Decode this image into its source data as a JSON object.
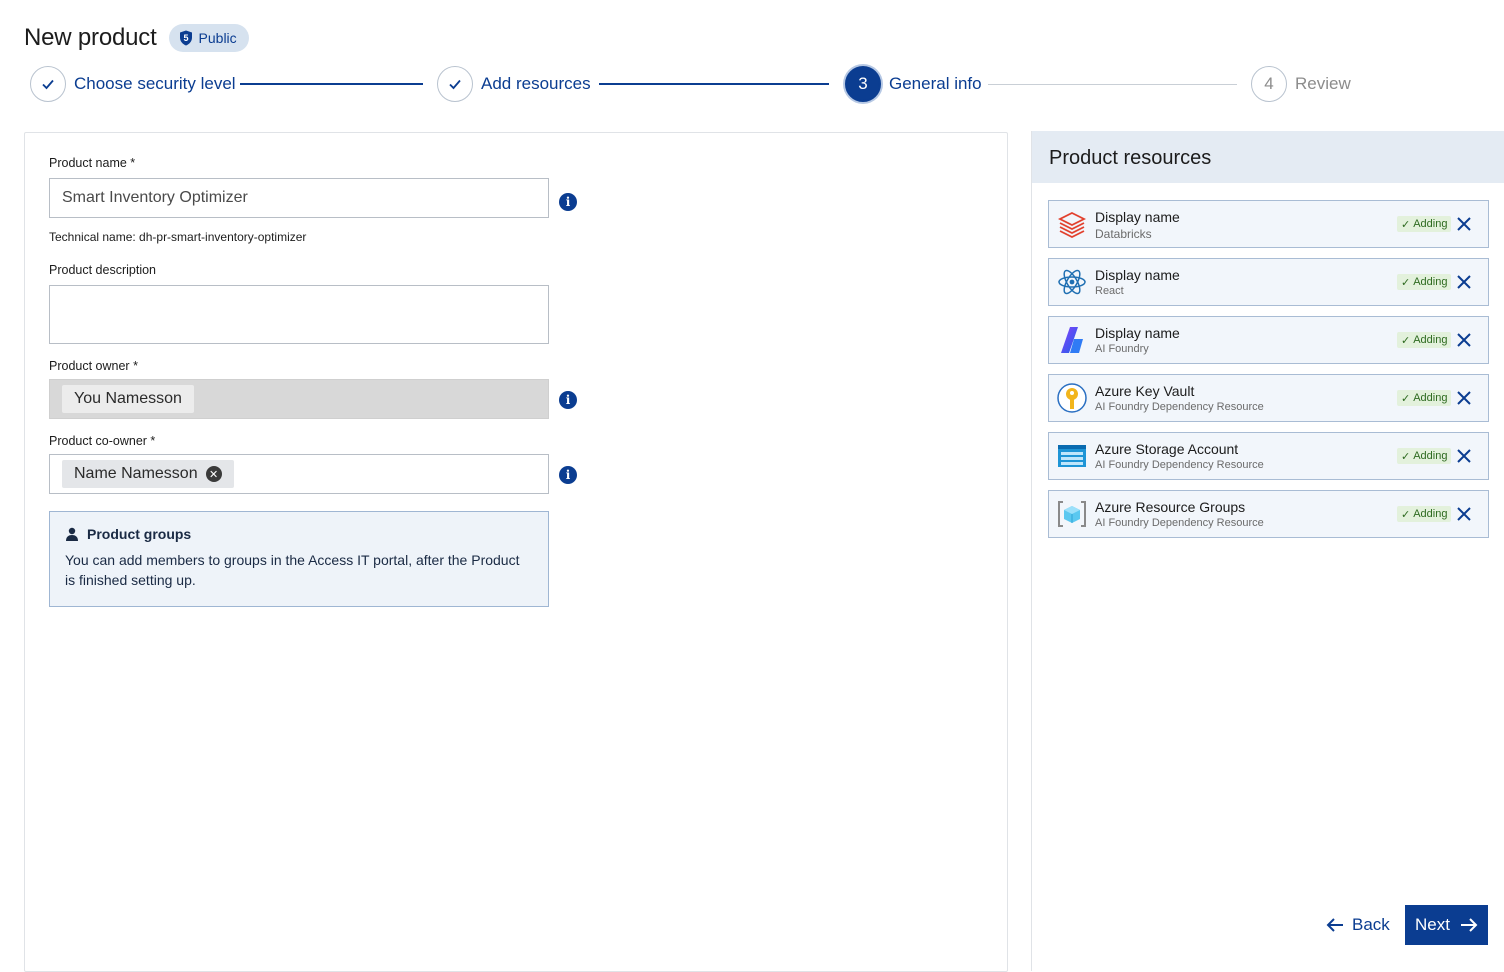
{
  "header": {
    "title": "New product",
    "security_badge": "Public"
  },
  "stepper": {
    "steps": [
      {
        "number": "1",
        "label": "Choose security level",
        "state": "done"
      },
      {
        "number": "2",
        "label": "Add resources",
        "state": "done"
      },
      {
        "number": "3",
        "label": "General info",
        "state": "active"
      },
      {
        "number": "4",
        "label": "Review",
        "state": "todo"
      }
    ]
  },
  "form": {
    "product_name": {
      "label": "Product name *",
      "value": "Smart Inventory Optimizer"
    },
    "technical_name": "Technical name: dh-pr-smart-inventory-optimizer",
    "product_description": {
      "label": "Product description",
      "value": ""
    },
    "product_owner": {
      "label": "Product owner *",
      "chip": "You Namesson"
    },
    "product_coowner": {
      "label": "Product co-owner *",
      "chip": "Name Namesson"
    },
    "groups_notice": {
      "title": "Product groups",
      "body": "You can add members to groups in the Access IT portal, after the Product is finished setting up."
    }
  },
  "resources": {
    "title": "Product resources",
    "items": [
      {
        "name": "Display name",
        "type": "Databricks",
        "status": "Adding",
        "icon": "databricks-icon"
      },
      {
        "name": "Display name",
        "type": "React",
        "status": "Adding",
        "icon": "react-icon"
      },
      {
        "name": "Display name",
        "type": "AI Foundry",
        "status": "Adding",
        "icon": "ai-foundry-icon"
      },
      {
        "name": "Azure Key Vault",
        "type": "AI Foundry Dependency Resource",
        "status": "Adding",
        "icon": "key-vault-icon"
      },
      {
        "name": "Azure Storage Account",
        "type": "AI Foundry Dependency Resource",
        "status": "Adding",
        "icon": "storage-account-icon"
      },
      {
        "name": "Azure Resource Groups",
        "type": "AI Foundry Dependency Resource",
        "status": "Adding",
        "icon": "resource-group-icon"
      }
    ]
  },
  "footer": {
    "back_label": "Back",
    "next_label": "Next"
  },
  "colors": {
    "primary": "#0b3d91",
    "panel_header": "#e4ebf3",
    "status_bg": "#e3f1dc",
    "status_fg": "#2d6a1f"
  }
}
